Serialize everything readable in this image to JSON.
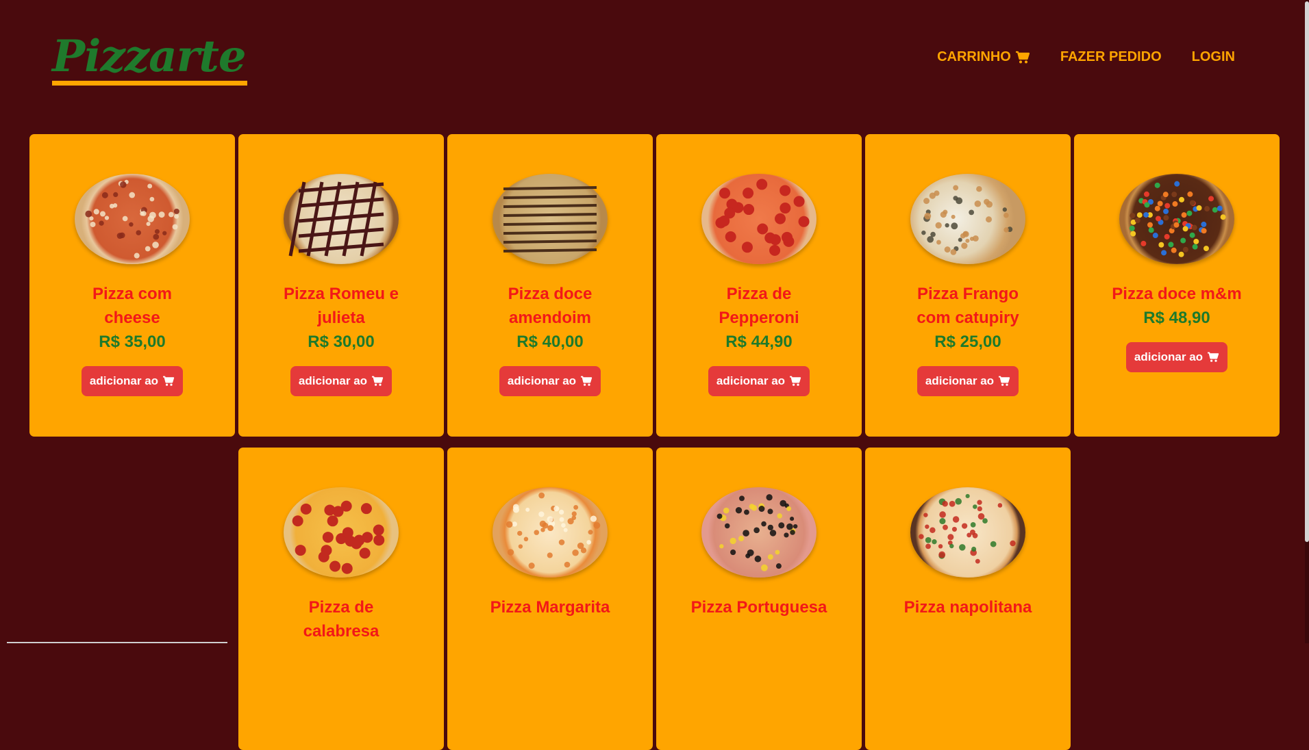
{
  "header": {
    "logo": "Pizzarte",
    "nav": [
      {
        "label": "CARRINHO",
        "icon": "cart-icon"
      },
      {
        "label": "FAZER PEDIDO"
      },
      {
        "label": "LOGIN"
      }
    ]
  },
  "add_button_label": "adicionar ao",
  "colors": {
    "background": "#4a0a0d",
    "card": "#ffa500",
    "name": "#f21818",
    "price": "#1d7a2b",
    "button": "#e53a3a",
    "logo": "#1f7a2c"
  },
  "products": [
    {
      "name": "Pizza com cheese",
      "price": "R$ 35,00",
      "style": "cheese"
    },
    {
      "name": "Pizza Romeu e julieta",
      "price": "R$ 30,00",
      "style": "romeu"
    },
    {
      "name": "Pizza doce amendoim",
      "price": "R$ 40,00",
      "style": "amendoim"
    },
    {
      "name": "Pizza de Pepperoni",
      "price": "R$ 44,90",
      "style": "pepperoni"
    },
    {
      "name": "Pizza Frango com catupiry",
      "price": "R$ 25,00",
      "style": "frango"
    },
    {
      "name": "Pizza doce m&m",
      "price": "R$ 48,90",
      "style": "mm"
    },
    {
      "name": "Pizza de calabresa",
      "price": "",
      "style": "calabresa"
    },
    {
      "name": "Pizza Margarita",
      "price": "",
      "style": "margarita"
    },
    {
      "name": "Pizza Portuguesa",
      "price": "",
      "style": "portuguesa"
    },
    {
      "name": "Pizza napolitana",
      "price": "",
      "style": "napolitana"
    }
  ]
}
